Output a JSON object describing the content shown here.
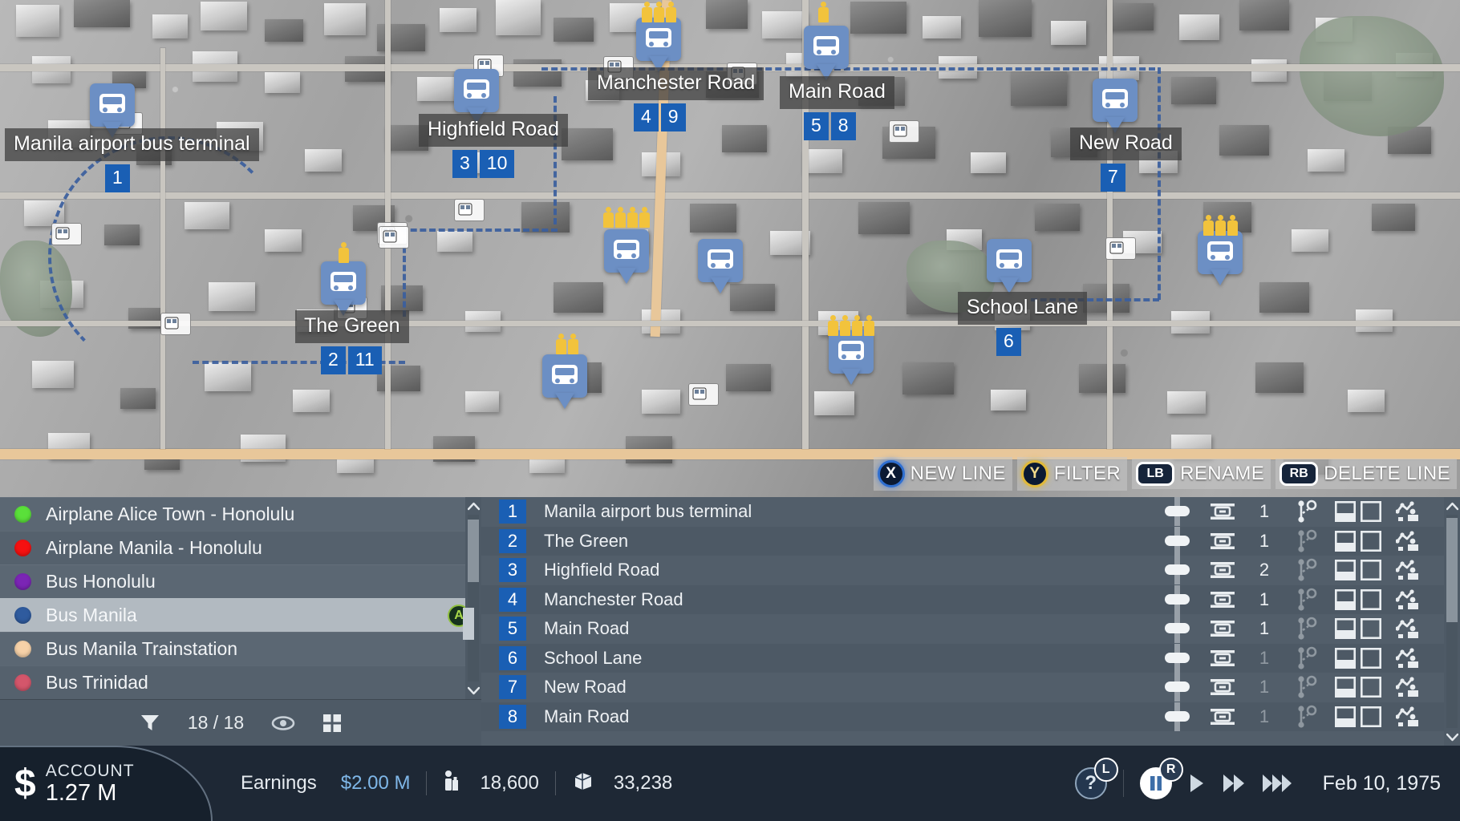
{
  "map": {
    "labels": [
      {
        "name": "Manila airport bus terminal",
        "numbers": [
          "1"
        ]
      },
      {
        "name": "Highfield Road",
        "numbers": [
          "3",
          "10"
        ]
      },
      {
        "name": "Manchester Road",
        "numbers": [
          "4",
          "9"
        ]
      },
      {
        "name": "Main Road",
        "numbers": [
          "5",
          "8"
        ]
      },
      {
        "name": "New Road",
        "numbers": [
          "7"
        ]
      },
      {
        "name": "The Green",
        "numbers": [
          "2",
          "11"
        ]
      },
      {
        "name": "School Lane",
        "numbers": [
          "6"
        ]
      }
    ],
    "pin_icon": "bus-icon",
    "waiting_passenger_icon": "pedestrian-icon",
    "line_color": "#3b5f9e"
  },
  "gamepad_hints": [
    {
      "button": "X",
      "label": "NEW LINE",
      "style": "x",
      "icon": "gamepad-x-button"
    },
    {
      "button": "Y",
      "label": "FILTER",
      "style": "y",
      "icon": "gamepad-y-button"
    },
    {
      "button": "LB",
      "label": "RENAME",
      "style": "sh",
      "icon": "gamepad-lb-button"
    },
    {
      "button": "RB",
      "label": "DELETE LINE",
      "style": "sh",
      "icon": "gamepad-rb-button"
    }
  ],
  "lines_panel": {
    "items": [
      {
        "name": "Airplane Alice Town - Honolulu",
        "color": "#5ae03a",
        "selected": false,
        "badge": ""
      },
      {
        "name": "Airplane Manila - Honolulu",
        "color": "#f51111",
        "selected": false,
        "badge": ""
      },
      {
        "name": "Bus Honolulu",
        "color": "#7b25b5",
        "selected": false,
        "badge": ""
      },
      {
        "name": "Bus Manila",
        "color": "#2f5b9e",
        "selected": true,
        "badge": "A"
      },
      {
        "name": "Bus Manila Trainstation",
        "color": "#f6d1a8",
        "selected": false,
        "badge": ""
      },
      {
        "name": "Bus Trinidad",
        "color": "#d4566b",
        "selected": false,
        "badge": ""
      }
    ],
    "footer": {
      "filter_icon": "filter-icon",
      "count": "18 / 18",
      "visibility_icon": "eye-icon",
      "grid_icon": "grid-icon"
    }
  },
  "stops_panel": {
    "rows": [
      {
        "num": "1",
        "name": "Manila airport bus terminal",
        "count": "1",
        "dim": false
      },
      {
        "num": "2",
        "name": "The Green",
        "count": "1",
        "dim": false
      },
      {
        "num": "3",
        "name": "Highfield Road",
        "count": "2",
        "dim": false
      },
      {
        "num": "4",
        "name": "Manchester Road",
        "count": "1",
        "dim": false
      },
      {
        "num": "5",
        "name": "Main Road",
        "count": "1",
        "dim": false
      },
      {
        "num": "6",
        "name": "School Lane",
        "count": "1",
        "dim": true
      },
      {
        "num": "7",
        "name": "New Road",
        "count": "1",
        "dim": true
      },
      {
        "num": "8",
        "name": "Main Road",
        "count": "1",
        "dim": true
      }
    ],
    "icons": {
      "slider": "position-slider",
      "platform": "platform-icon",
      "branch": "route-branch-icon",
      "box_a": "toggle-box-filled",
      "box_b": "toggle-box-empty",
      "waiting": "passenger-waiting-icon"
    }
  },
  "status_bar": {
    "account_label": "ACCOUNT",
    "account_value": "1.27 M",
    "currency_icon": "dollar-icon",
    "earnings_label": "Earnings",
    "earnings_value": "$2.00 M",
    "passengers_icon": "passenger-icon",
    "passengers_value": "18,600",
    "cargo_icon": "cargo-box-icon",
    "cargo_value": "33,238",
    "help_button": "?",
    "help_key": "L",
    "pause_key": "R",
    "date": "Feb 10, 1975"
  }
}
